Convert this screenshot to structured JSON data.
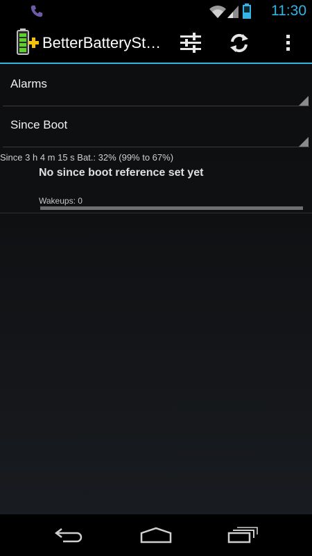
{
  "status_bar": {
    "time": "11:30",
    "icons": [
      "phone-icon",
      "wifi-icon",
      "signal-icon",
      "battery-icon"
    ]
  },
  "action_bar": {
    "title": "BetterBatterySt…",
    "app_icon": "battery-plus-icon",
    "buttons": [
      "settings-sliders-icon",
      "refresh-icon",
      "overflow-menu-icon"
    ]
  },
  "spinners": {
    "alarms": "Alarms",
    "since_boot": "Since Boot"
  },
  "summary": {
    "since": "Since 3 h 4 m 15 s  Bat.: 32% (99% to 67%)"
  },
  "entry": {
    "title": "No since boot reference set yet",
    "wakeups": "Wakeups: 0",
    "progress": 1.0
  },
  "nav_bar": {
    "buttons": [
      "back-icon",
      "home-icon",
      "recent-apps-icon"
    ]
  },
  "colors": {
    "accent": "#33b5e5",
    "battery_green": "#5fcf2d",
    "plus_yellow": "#f4c20d"
  }
}
